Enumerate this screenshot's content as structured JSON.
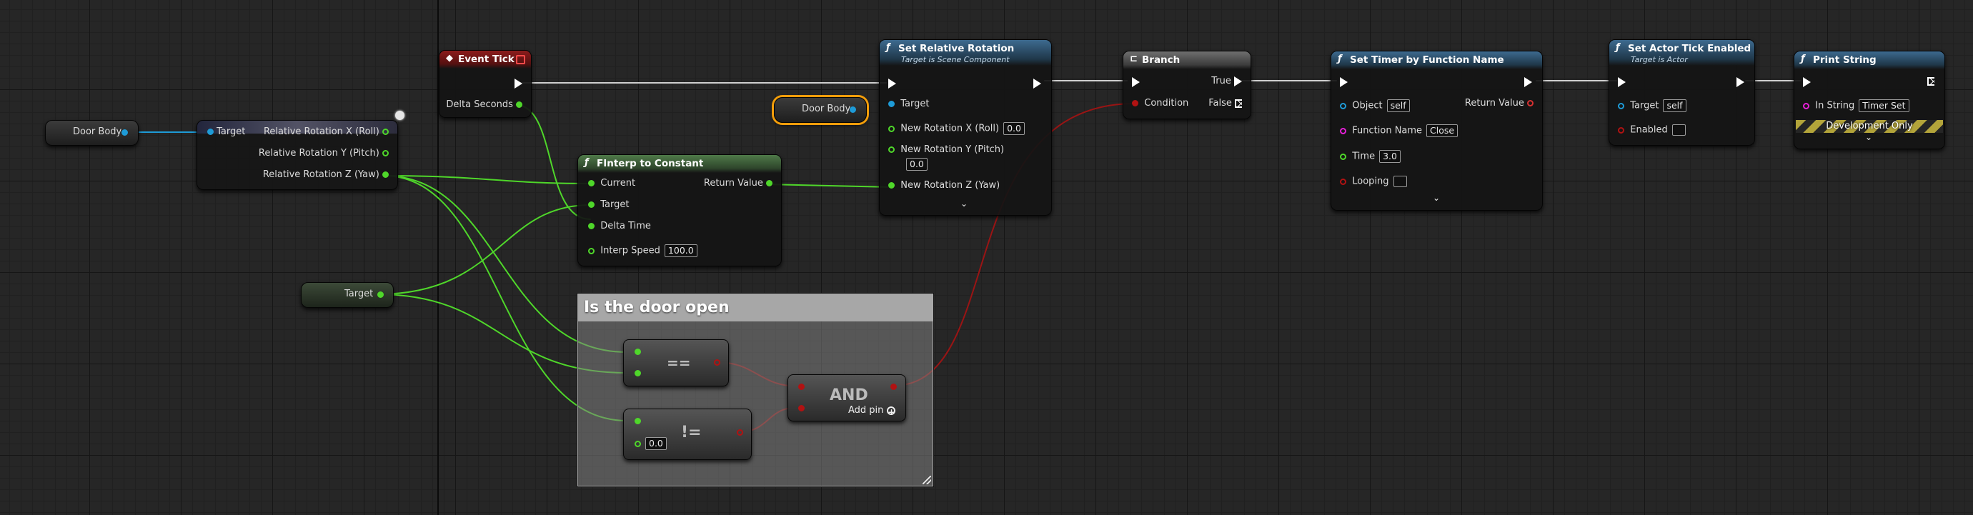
{
  "graph": {
    "nodes": {
      "door_body_var": {
        "label": "Door Body"
      },
      "door_body_var_selected": {
        "label": "Door Body"
      },
      "target_var": {
        "label": "Target"
      },
      "get_rotation": {
        "target": "Target",
        "out_x": "Relative Rotation X (Roll)",
        "out_y": "Relative Rotation Y (Pitch)",
        "out_z": "Relative Rotation Z (Yaw)"
      },
      "event_tick": {
        "title": "Event Tick",
        "delta": "Delta Seconds"
      },
      "finterp": {
        "title": "FInterp to Constant",
        "current": "Current",
        "target": "Target",
        "delta_time": "Delta Time",
        "interp_speed": "Interp Speed",
        "interp_speed_value": "100.0",
        "return_value": "Return Value"
      },
      "set_rel_rot": {
        "title": "Set Relative Rotation",
        "subtitle": "Target is Scene Component",
        "target": "Target",
        "rx": "New Rotation X (Roll)",
        "rx_value": "0.0",
        "ry": "New Rotation Y (Pitch)",
        "ry_value": "0.0",
        "rz": "New Rotation Z (Yaw)"
      },
      "branch": {
        "title": "Branch",
        "condition": "Condition",
        "true_label": "True",
        "false_label": "False"
      },
      "set_timer": {
        "title": "Set Timer by Function Name",
        "object": "Object",
        "object_value": "self",
        "function_name": "Function Name",
        "function_name_value": "Close",
        "time": "Time",
        "time_value": "3.0",
        "looping": "Looping",
        "return_value": "Return Value"
      },
      "set_tick": {
        "title": "Set Actor Tick Enabled",
        "subtitle": "Target is Actor",
        "target": "Target",
        "target_value": "self",
        "enabled": "Enabled"
      },
      "print_string": {
        "title": "Print String",
        "in_string": "In String",
        "in_string_value": "Timer Set",
        "dev_only": "Development Only"
      },
      "equal_op": {
        "label": "=="
      },
      "notequal_op": {
        "label": "!=",
        "value": "0.0"
      },
      "and_op": {
        "label": "AND",
        "add_pin": "Add pin"
      }
    },
    "comment": {
      "title": "Is the door open"
    }
  },
  "colors": {
    "exec_wire": "#ffffff",
    "object_pin": "#1e9bd7",
    "float_pin": "#4fd72a",
    "bool_pin": "#b11212",
    "string_pin": "#e61fd8",
    "function_header": "#3d6a8f",
    "event_header": "#8c1c1c",
    "selection_outline": "#f29d0a"
  },
  "icons": {
    "function": "function-icon",
    "event": "event-diamond-icon",
    "branch": "branch-icon",
    "expand": "chevron-down-icon",
    "add_pin": "plus-circle-icon"
  }
}
